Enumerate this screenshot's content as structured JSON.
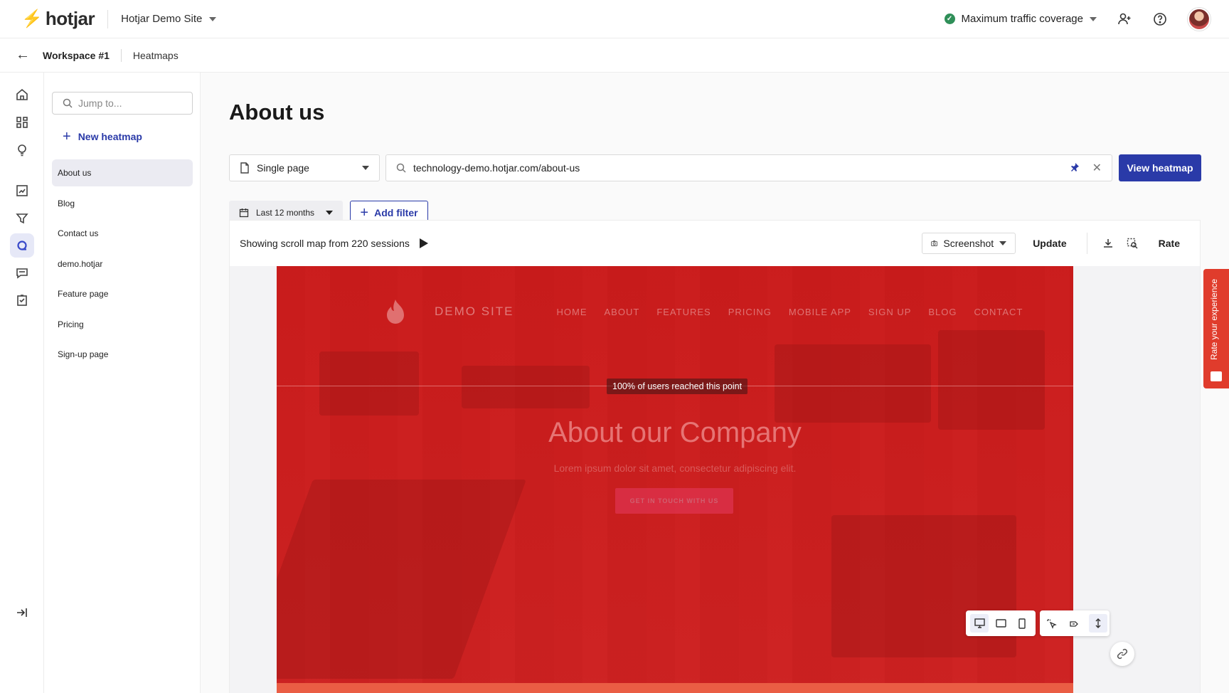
{
  "topbar": {
    "brand": "hotjar",
    "site_name": "Hotjar Demo Site",
    "coverage_label": "Maximum traffic coverage",
    "icons": [
      "add-user-icon",
      "help-icon"
    ]
  },
  "breadcrumb": {
    "workspace": "Workspace #1",
    "section": "Heatmaps"
  },
  "rail": {
    "items": [
      "home-icon",
      "dashboard-icon",
      "lightbulb-icon",
      "trends-icon",
      "funnels-icon",
      "heatmaps-icon",
      "feedback-icon",
      "surveys-icon"
    ],
    "active": "heatmaps-icon",
    "collapse_icon": "collapse-icon"
  },
  "sidebar": {
    "search_placeholder": "Jump to...",
    "new_label": "New heatmap",
    "items": [
      {
        "label": "About us"
      },
      {
        "label": "Blog"
      },
      {
        "label": "Contact us"
      },
      {
        "label": "demo.hotjar"
      },
      {
        "label": "Feature page"
      },
      {
        "label": "Pricing"
      },
      {
        "label": "Sign-up page"
      }
    ],
    "active_index": 0
  },
  "main": {
    "title": "About us",
    "page_type": "Single page",
    "url": "technology-demo.hotjar.com/about-us",
    "view_button": "View heatmap",
    "date_range": "Last 12 months",
    "add_filter": "Add filter"
  },
  "panel": {
    "summary": "Showing scroll map from 220 sessions",
    "screenshot_label": "Screenshot",
    "update_label": "Update",
    "rate_label": "Rate"
  },
  "preview": {
    "brand": "DEMO SITE",
    "nav": [
      "HOME",
      "ABOUT",
      "FEATURES",
      "PRICING",
      "MOBILE APP",
      "SIGN UP",
      "BLOG",
      "CONTACT"
    ],
    "reach_label": "100% of users reached this point",
    "hero_title": "About our Company",
    "hero_sub": "Lorem ipsum dolor sit amet, consectetur adipiscing elit.",
    "cta": "GET IN TOUCH WITH US",
    "heat_color": "#cc1a1a"
  },
  "feedback_tab": {
    "label": "Rate your experience"
  },
  "colors": {
    "accent": "#2a3aa8",
    "brand": "#ff3c00",
    "status_ok": "#2f8f58"
  }
}
